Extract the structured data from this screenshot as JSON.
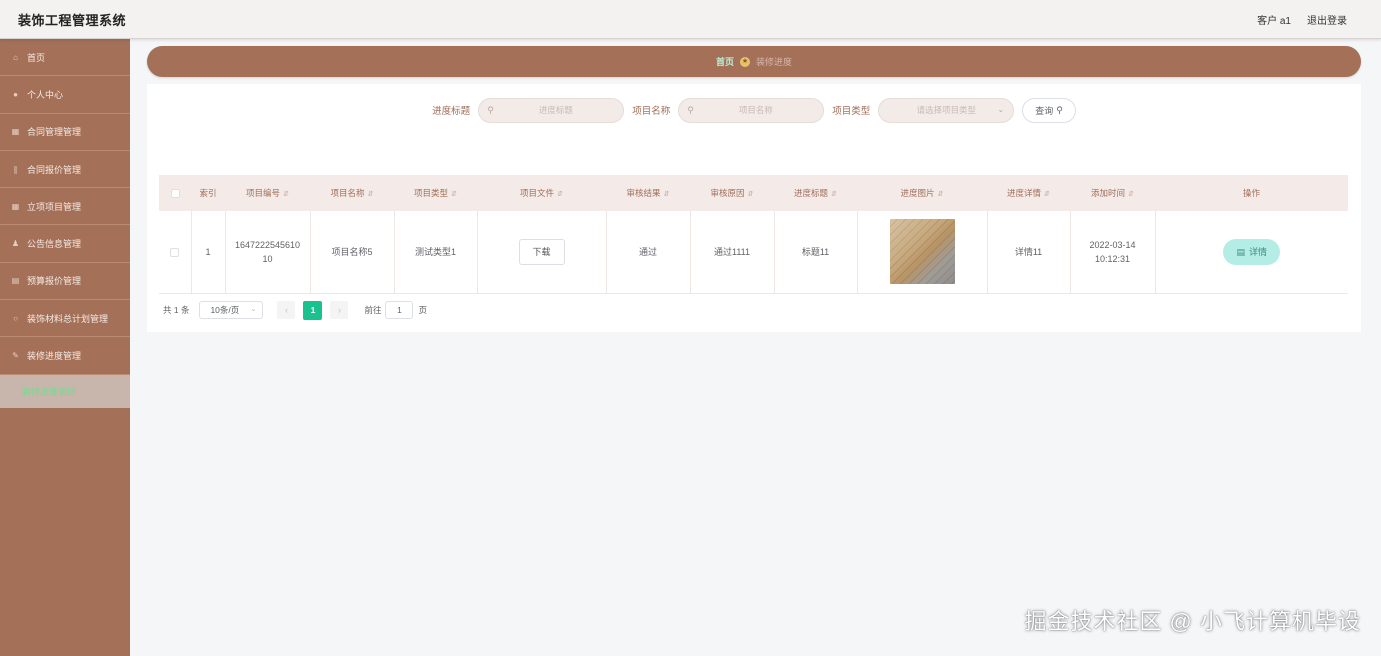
{
  "header": {
    "title": "装饰工程管理系统",
    "user_label": "客户 a1",
    "logout_label": "退出登录"
  },
  "sidebar": {
    "items": [
      {
        "label": "首页",
        "icon": "home-icon",
        "glyph": "⌂"
      },
      {
        "label": "个人中心",
        "icon": "user-icon",
        "glyph": "●"
      },
      {
        "label": "合同管理管理",
        "icon": "contract-icon",
        "glyph": "▦"
      },
      {
        "label": "合同报价管理",
        "icon": "quote-icon",
        "glyph": "∥"
      },
      {
        "label": "立项项目管理",
        "icon": "project-icon",
        "glyph": "▦"
      },
      {
        "label": "公告信息管理",
        "icon": "notice-icon",
        "glyph": "♟"
      },
      {
        "label": "预算报价管理",
        "icon": "budget-icon",
        "glyph": "▤"
      },
      {
        "label": "装饰材料总计划管理",
        "icon": "material-icon",
        "glyph": "○"
      },
      {
        "label": "装修进度管理",
        "icon": "progress-icon",
        "glyph": "✎"
      }
    ],
    "sub_item": "装修进度管理"
  },
  "breadcrumb": {
    "home": "首页",
    "current": "装修进度"
  },
  "search": {
    "title_label": "进度标题",
    "title_placeholder": "进度标题",
    "name_label": "项目名称",
    "name_placeholder": "项目名称",
    "type_label": "项目类型",
    "type_placeholder": "请选择项目类型",
    "query_label": "查询"
  },
  "table": {
    "columns": [
      "索引",
      "项目编号",
      "项目名称",
      "项目类型",
      "项目文件",
      "审核结果",
      "审核原因",
      "进度标题",
      "进度图片",
      "进度详情",
      "添加时间",
      "操作"
    ],
    "rows": [
      {
        "index": "1",
        "project_no": "1647222545610 10",
        "project_name": "项目名称5",
        "project_type": "测试类型1",
        "file_button": "下载",
        "audit_result": "通过",
        "audit_reason": "通过1111",
        "progress_title": "标题11",
        "progress_detail": "详情11",
        "added_time": "2022-03-14 10:12:31",
        "action_label": "详情"
      }
    ]
  },
  "pagination": {
    "total": "共 1 条",
    "page_size": "10条/页",
    "prev": "‹",
    "current_page": "1",
    "next": "›",
    "goto_label": "前往",
    "goto_value": "1",
    "page_suffix": "页"
  },
  "watermark": "掘金技术社区 @ 小飞计算机毕设",
  "colors": {
    "sidebar_bg": "#a47058",
    "accent_green": "#19c28e",
    "detail_button_bg": "#b4ede6"
  }
}
